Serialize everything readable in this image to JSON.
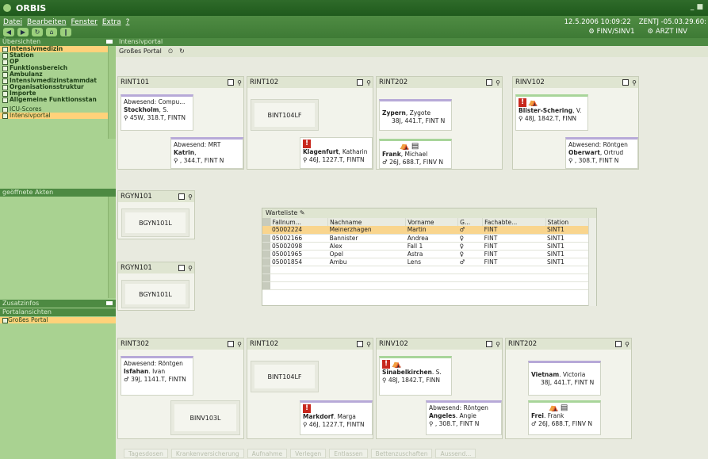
{
  "app": {
    "title": "ORBIS"
  },
  "menu": {
    "items": [
      "Datei",
      "Bearbeiten",
      "Fenster",
      "Extra",
      "?"
    ]
  },
  "header": {
    "timestamp": "12.5.2006 10:09:22",
    "zentrum": "ZENTJ -05.03.29.60:",
    "location1": "FINV/SINV1",
    "location2": "ARZT INV"
  },
  "sidebar": {
    "overview_title": "Übersichten",
    "nav": [
      "Intensivmedizin",
      "Station",
      "OP",
      "Funktionsbereich",
      "Ambulanz",
      "Intensivmedizinstammdat",
      "Organisationsstruktur",
      "Importe",
      "Allgemeine Funktionsstan"
    ],
    "sub": [
      "ICU-Scores",
      "Intensivportal"
    ],
    "open_files_title": "geöffnete Akten",
    "extra_title": "Zusatzinfos",
    "portal_title": "Portalansichten",
    "portal_item": "Großes Portal"
  },
  "main": {
    "crumb": "Intensivportal",
    "portal": "Großes Portal"
  },
  "rooms": {
    "r1": {
      "name": "RINT101",
      "a_absent": "Abwesend: Compu...",
      "a_name": "Stockholm",
      "a_first": ", S.",
      "a_id": "45W, 318.T, FINTN",
      "b_absent": "Abwesend: MRT",
      "b_name": "Katrin",
      "b_first": ",",
      "b_id": ", 344.T, FINT      N"
    },
    "r2": {
      "name": "RINT102",
      "empty": "BINT104LF",
      "b_name": "Klagenfurt",
      "b_first": ", Katharin",
      "b_id": "46J, 1227.T, FINTN"
    },
    "r3": {
      "name": "RINT202",
      "a_name": "Zypern",
      "a_first": ", Zygote",
      "a_id": "38J, 441.T, FINT N",
      "b_name": "Frank",
      "b_first": ", Michael",
      "b_id": "26J, 688.T, FINV N"
    },
    "r4": {
      "name": "RINV102",
      "a_name": "Blister-Schering",
      "a_first": ", V.",
      "a_id": "48J, 1842.T, FINN",
      "b_absent": "Abwesend: Röntgen",
      "b_name": "Oberwart",
      "b_first": ", Ortrud",
      "b_id": ", 308.T, FINT      N"
    },
    "r5": {
      "name": "RGYN101",
      "empty": "BGYN101L"
    },
    "r6": {
      "name": "RGYN101",
      "empty": "BGYN101L"
    },
    "r7": {
      "name": "RINT302",
      "a_absent": "Abwesend: Röntgen",
      "a_name": "Isfahan",
      "a_first": ". Ivan",
      "a_id": "39J, 1141.T, FINTN",
      "empty": "BINV103L"
    },
    "r8": {
      "name": "RINT102",
      "empty": "BINT104LF",
      "b_name": "Markdorf",
      "b_first": ". Marga",
      "b_id": "46J, 1227.T, FINTN"
    },
    "r9": {
      "name": "RINV102",
      "a_name": "Sinabelkirchen",
      "a_first": ". S.",
      "a_id": "48J, 1842.T, FINN",
      "b_absent": "Abwesend: Röntgen",
      "b_name": "Angeles",
      "b_first": ". Angie",
      "b_id": ", 308.T, FINT      N"
    },
    "r10": {
      "name": "RINT202",
      "a_name": "Vietnam",
      "a_first": ". Victoria",
      "a_id": "38J, 441.T, FINT N",
      "b_name": "Frei",
      "b_first": ". Frank",
      "b_id": "26J, 688.T, FINV N"
    }
  },
  "waitlist": {
    "tab": "Warteliste",
    "columns": [
      "Fallnum...",
      "Nachname",
      "Vorname",
      "G...",
      "Fachabte...",
      "Station"
    ],
    "rows": [
      [
        "05002224",
        "Meinerzhagen",
        "Martin",
        "♂",
        "FINT",
        "SINT1"
      ],
      [
        "05002166",
        "Bannister",
        "Andrea",
        "♀",
        "FINT",
        "SINT1"
      ],
      [
        "05002098",
        "Alex",
        "Fall 1",
        "♀",
        "FINT",
        "SINT1"
      ],
      [
        "05001965",
        "Opel",
        "Astra",
        "♀",
        "FINT",
        "SINT1"
      ],
      [
        "05001854",
        "Ambu",
        "Lens",
        "♂",
        "FINT",
        "SINT1"
      ]
    ]
  },
  "actions": [
    "Tagesdosen",
    "Krankenversicherung",
    "Aufnahme",
    "Verlegen",
    "Entlassen",
    "Bettenzuschaften",
    "Aussend..."
  ]
}
